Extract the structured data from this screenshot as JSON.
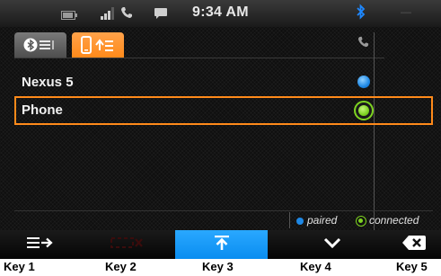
{
  "statusbar": {
    "time": "9:34 AM",
    "bluetooth_icon": "bluetooth-icon",
    "bluetooth_color": "#1e88ff"
  },
  "tabs": [
    {
      "name": "bluetooth-devices-tab",
      "icon": "bluetooth-list-icon",
      "active": false
    },
    {
      "name": "phone-tab",
      "icon": "phone-transfer-icon",
      "active": true
    }
  ],
  "devices": [
    {
      "label": "Nexus 5",
      "status": "paired"
    },
    {
      "label": "Phone",
      "status": "connected",
      "selected": true
    }
  ],
  "legend": {
    "paired": "paired",
    "connected": "connected"
  },
  "softkeys": [
    {
      "name": "key1-forward-list-button",
      "icon": "list-arrow-icon",
      "enabled": true
    },
    {
      "name": "key2-disconnect-button",
      "icon": "disconnect-icon",
      "enabled": false
    },
    {
      "name": "key3-transfer-button",
      "icon": "upload-arrow-icon",
      "enabled": true,
      "active": true
    },
    {
      "name": "key4-down-button",
      "icon": "chevron-down-icon",
      "enabled": true
    },
    {
      "name": "key5-delete-button",
      "icon": "backspace-icon",
      "enabled": true
    }
  ],
  "key_labels": [
    "Key 1",
    "Key 2",
    "Key 3",
    "Key 4",
    "Key 5"
  ],
  "colors": {
    "accent_orange": "#ff8a1a",
    "paired_blue": "#1e88e5",
    "connected_green": "#7ed321",
    "active_key_blue": "#0a8df0"
  }
}
